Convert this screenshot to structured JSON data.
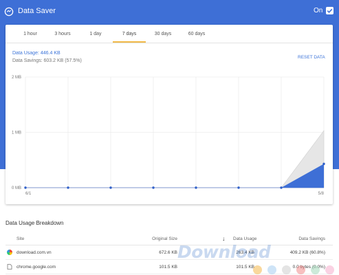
{
  "header": {
    "title": "Data Saver",
    "toggle_label": "On",
    "toggle_checked": true
  },
  "tabs": [
    {
      "label": "1 hour",
      "active": false
    },
    {
      "label": "3 hours",
      "active": false
    },
    {
      "label": "1 day",
      "active": false
    },
    {
      "label": "7 days",
      "active": true
    },
    {
      "label": "30 days",
      "active": false
    },
    {
      "label": "60 days",
      "active": false
    }
  ],
  "summary": {
    "usage": "Data Usage: 446.4 KB",
    "savings": "Data Savings: 603.2 KB (57.5%)",
    "reset_label": "RESET DATA"
  },
  "chart_data": {
    "type": "area",
    "y_ticks": [
      "2 MB",
      "1 MB",
      "0 MB"
    ],
    "ylim": [
      0,
      2
    ],
    "x_labels": [
      "6/1",
      "5/8"
    ],
    "series": [
      {
        "name": "Data Usage",
        "values": [
          0,
          0,
          0,
          0,
          0,
          0,
          0,
          0.43
        ]
      },
      {
        "name": "Original Size",
        "values": [
          0,
          0,
          0,
          0,
          0,
          0,
          0,
          1.03
        ]
      }
    ],
    "colors": {
      "usage": "#3e6fd6",
      "original": "#e6e6e6",
      "points": "#2f5fc9"
    }
  },
  "breakdown": {
    "title": "Data Usage Breakdown",
    "columns": {
      "site": "Site",
      "original": "Original Size",
      "usage": "Data Usage",
      "savings": "Data Savings"
    },
    "rows": [
      {
        "site": "download.com.vn",
        "original": "672.6 KB",
        "usage": "263.4 KB",
        "savings": "409.2 KB (60.8%)"
      },
      {
        "site": "chrome.google.com",
        "original": "101.5 KB",
        "usage": "101.5 KB",
        "savings": "0.0 bytes (0.0%)"
      }
    ]
  },
  "watermark": "Download",
  "watermark_dot_colors": [
    "#f3b23a",
    "#9ec9f0",
    "#c9c9c9",
    "#f08080",
    "#9ad6b4",
    "#f6a6c8"
  ]
}
